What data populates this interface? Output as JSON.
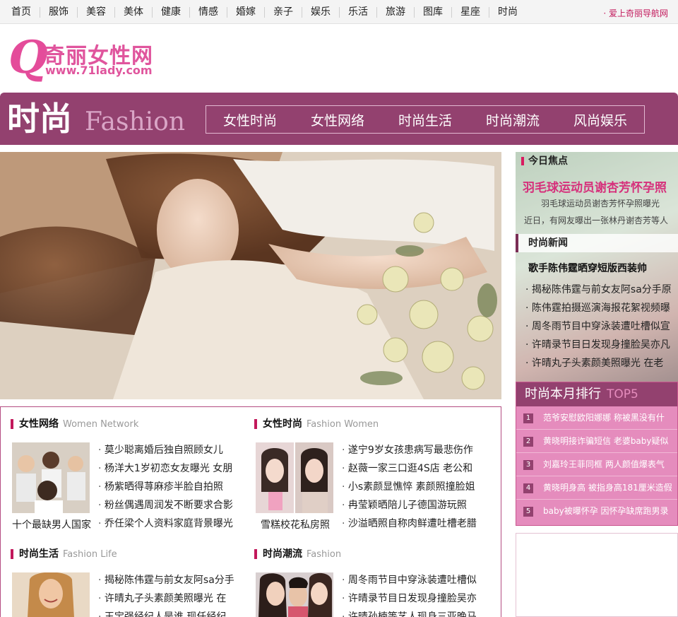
{
  "topnav": {
    "items": [
      "首页",
      "服饰",
      "美容",
      "美体",
      "健康",
      "情感",
      "婚嫁",
      "亲子",
      "娱乐",
      "乐活",
      "旅游",
      "图库",
      "星座",
      "时尚"
    ],
    "right_link": "· 爱上奇丽导航网"
  },
  "logo": {
    "q": "Q",
    "name": "奇丽女性网",
    "url": "www.71lady.com"
  },
  "banner": {
    "title_cn": "时尚",
    "title_en": "Fashion",
    "subnav": [
      "女性时尚",
      "女性网络",
      "时尚生活",
      "时尚潮流",
      "风尚娱乐"
    ]
  },
  "focus": {
    "heading": "今日焦点",
    "headline": "羽毛球运动员谢杏芳怀孕照",
    "sub1": "羽毛球运动员谢杏芳怀孕照曝光",
    "sub2": "近日，有网友曝出一张林丹谢杏芳等人"
  },
  "news": {
    "heading": "时尚新闻",
    "title": "歌手陈伟霆晒穿短版西装帅",
    "items": [
      "揭秘陈伟霆与前女友阿sa分手原",
      "陈伟霆拍摄巡演海报花絮视频曝",
      "周冬雨节目中穿泳装遭吐槽似宣",
      "许晴录节目日发现身撞脸吴亦凡",
      "许晴丸子头素颜美照曝光 在老"
    ]
  },
  "ranking": {
    "title": "时尚本月排行",
    "badge": "TOP5",
    "items": [
      {
        "num": "1",
        "text": "范爷安慰欧阳娜娜 称被黑没有什"
      },
      {
        "num": "2",
        "text": "黄晓明接诈骗短信 老婆baby疑似"
      },
      {
        "num": "3",
        "text": "刘嘉玲王菲同框 两人颜值爆表气"
      },
      {
        "num": "4",
        "text": "黄晓明身高 被指身高181厘米造假"
      },
      {
        "num": "5",
        "text": "baby被曝怀孕 因怀孕缺席跑男录"
      }
    ]
  },
  "sections": {
    "women_network": {
      "title": "女性网络",
      "title_en": "Women Network",
      "caption": "十个最缺男人国家",
      "items": [
        "莫少聪离婚后独自照顾女儿",
        "杨洋大1岁初恋女友曝光 女朋",
        "杨紫晒得荨麻疹半脸自拍照",
        "粉丝偶遇周润发不断要求合影",
        "乔任梁个人资料家庭背景曝光"
      ]
    },
    "fashion_women": {
      "title": "女性时尚",
      "title_en": "Fashion Women",
      "caption": "雪糕校花私房照",
      "items": [
        "遂宁9岁女孩患病写最悲伤作",
        "赵薇一家三口逛4S店 老公和",
        "小s素颜显憔悴 素颜照撞脸姐",
        "冉莹颖晒陪儿子德国游玩照",
        "沙溢晒照自称肉鲜遭吐槽老腊"
      ]
    },
    "fashion_life": {
      "title": "时尚生活",
      "title_en": "Fashion Life",
      "items": [
        "揭秘陈伟霆与前女友阿sa分手",
        "许晴丸子头素颜美照曝光 在",
        "王宝强经纪人是谁 现任经纪"
      ]
    },
    "fashion_trend": {
      "title": "时尚潮流",
      "title_en": "Fashion",
      "items": [
        "周冬雨节目中穿泳装遭吐槽似",
        "许晴录节目日发现身撞脸吴亦",
        "许晴孙楠等艺人现身三亚晚马"
      ]
    }
  }
}
